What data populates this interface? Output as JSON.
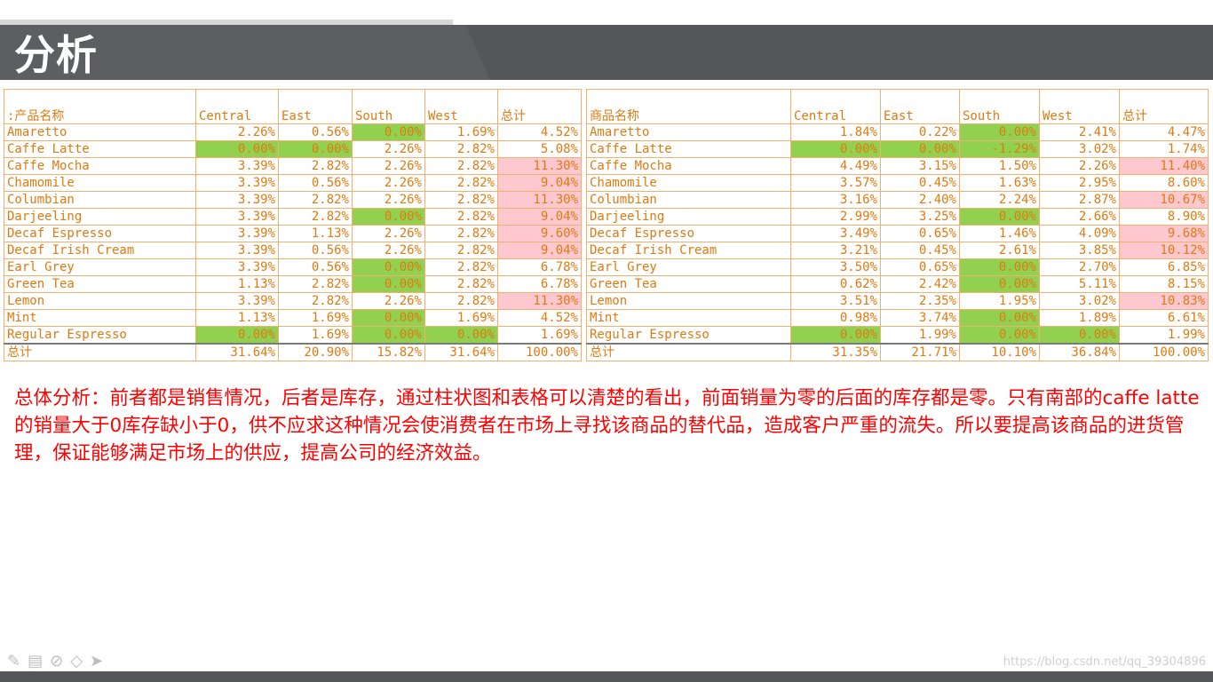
{
  "slide": {
    "title": "分析",
    "analysis_text": "总体分析：前者都是销售情况，后者是库存，通过柱状图和表格可以清楚的看出，前面销量为零的后面的库存都是零。只有南部的caffe latte的销量大于0库存缺小于0，供不应求这种情况会使消费者在市场上寻找该商品的替代品，造成客户严重的流失。所以要提高该商品的进货管理，保证能够满足市场上的供应，提高公司的经济效益。",
    "watermark": "https://blog.csdn.net/qq_39304896"
  },
  "icons": [
    "pen-icon",
    "slide-icon",
    "highlighter-icon",
    "eraser-icon",
    "pointer-icon"
  ],
  "colors": {
    "header_bg": "#545659",
    "text_orange": "#e07a10",
    "green_fill": "#92d050",
    "pink_fill": "#ffc7ce",
    "analysis_red": "#ff0000"
  },
  "tables": [
    {
      "corner": ":产品名称",
      "columns": [
        "Central",
        "East",
        "South",
        "West",
        "总计"
      ],
      "rows": [
        {
          "name": "Amaretto",
          "vals": [
            "2.26%",
            "0.56%",
            "0.00%",
            "1.69%",
            "4.52%"
          ],
          "fills": [
            "",
            "",
            "g",
            "",
            ""
          ]
        },
        {
          "name": "Caffe Latte",
          "vals": [
            "0.00%",
            "0.00%",
            "2.26%",
            "2.82%",
            "5.08%"
          ],
          "fills": [
            "g",
            "g",
            "",
            "",
            ""
          ]
        },
        {
          "name": "Caffe Mocha",
          "vals": [
            "3.39%",
            "2.82%",
            "2.26%",
            "2.82%",
            "11.30%"
          ],
          "fills": [
            "",
            "",
            "",
            "",
            "p"
          ]
        },
        {
          "name": "Chamomile",
          "vals": [
            "3.39%",
            "0.56%",
            "2.26%",
            "2.82%",
            "9.04%"
          ],
          "fills": [
            "",
            "",
            "",
            "",
            "p"
          ]
        },
        {
          "name": "Columbian",
          "vals": [
            "3.39%",
            "2.82%",
            "2.26%",
            "2.82%",
            "11.30%"
          ],
          "fills": [
            "",
            "",
            "",
            "",
            "p"
          ]
        },
        {
          "name": "Darjeeling",
          "vals": [
            "3.39%",
            "2.82%",
            "0.00%",
            "2.82%",
            "9.04%"
          ],
          "fills": [
            "",
            "",
            "g",
            "",
            "p"
          ]
        },
        {
          "name": "Decaf Espresso",
          "vals": [
            "3.39%",
            "1.13%",
            "2.26%",
            "2.82%",
            "9.60%"
          ],
          "fills": [
            "",
            "",
            "",
            "",
            "p"
          ]
        },
        {
          "name": "Decaf Irish Cream",
          "vals": [
            "3.39%",
            "0.56%",
            "2.26%",
            "2.82%",
            "9.04%"
          ],
          "fills": [
            "",
            "",
            "",
            "",
            "p"
          ]
        },
        {
          "name": "Earl Grey",
          "vals": [
            "3.39%",
            "0.56%",
            "0.00%",
            "2.82%",
            "6.78%"
          ],
          "fills": [
            "",
            "",
            "g",
            "",
            ""
          ]
        },
        {
          "name": "Green Tea",
          "vals": [
            "1.13%",
            "2.82%",
            "0.00%",
            "2.82%",
            "6.78%"
          ],
          "fills": [
            "",
            "",
            "g",
            "",
            ""
          ]
        },
        {
          "name": "Lemon",
          "vals": [
            "3.39%",
            "2.82%",
            "2.26%",
            "2.82%",
            "11.30%"
          ],
          "fills": [
            "",
            "",
            "",
            "",
            "p"
          ]
        },
        {
          "name": "Mint",
          "vals": [
            "1.13%",
            "1.69%",
            "0.00%",
            "1.69%",
            "4.52%"
          ],
          "fills": [
            "",
            "",
            "g",
            "",
            ""
          ]
        },
        {
          "name": "Regular Espresso",
          "vals": [
            "0.00%",
            "1.69%",
            "0.00%",
            "0.00%",
            "1.69%"
          ],
          "fills": [
            "g",
            "",
            "g",
            "g",
            ""
          ]
        }
      ],
      "total": {
        "name": "总计",
        "vals": [
          "31.64%",
          "20.90%",
          "15.82%",
          "31.64%",
          "100.00%"
        ]
      }
    },
    {
      "corner": "商品名称",
      "columns": [
        "Central",
        "East",
        "South",
        "West",
        "总计"
      ],
      "rows": [
        {
          "name": "Amaretto",
          "vals": [
            "1.84%",
            "0.22%",
            "0.00%",
            "2.41%",
            "4.47%"
          ],
          "fills": [
            "",
            "",
            "g",
            "",
            ""
          ]
        },
        {
          "name": "Caffe Latte",
          "vals": [
            "0.00%",
            "0.00%",
            "-1.29%",
            "3.02%",
            "1.74%"
          ],
          "fills": [
            "g",
            "g",
            "g",
            "",
            ""
          ]
        },
        {
          "name": "Caffe Mocha",
          "vals": [
            "4.49%",
            "3.15%",
            "1.50%",
            "2.26%",
            "11.40%"
          ],
          "fills": [
            "",
            "",
            "",
            "",
            "p"
          ]
        },
        {
          "name": "Chamomile",
          "vals": [
            "3.57%",
            "0.45%",
            "1.63%",
            "2.95%",
            "8.60%"
          ],
          "fills": [
            "",
            "",
            "",
            "",
            ""
          ]
        },
        {
          "name": "Columbian",
          "vals": [
            "3.16%",
            "2.40%",
            "2.24%",
            "2.87%",
            "10.67%"
          ],
          "fills": [
            "",
            "",
            "",
            "",
            "p"
          ]
        },
        {
          "name": "Darjeeling",
          "vals": [
            "2.99%",
            "3.25%",
            "0.00%",
            "2.66%",
            "8.90%"
          ],
          "fills": [
            "",
            "",
            "g",
            "",
            ""
          ]
        },
        {
          "name": "Decaf Espresso",
          "vals": [
            "3.49%",
            "0.65%",
            "1.46%",
            "4.09%",
            "9.68%"
          ],
          "fills": [
            "",
            "",
            "",
            "",
            "p"
          ]
        },
        {
          "name": "Decaf Irish Cream",
          "vals": [
            "3.21%",
            "0.45%",
            "2.61%",
            "3.85%",
            "10.12%"
          ],
          "fills": [
            "",
            "",
            "",
            "",
            "p"
          ]
        },
        {
          "name": "Earl Grey",
          "vals": [
            "3.50%",
            "0.65%",
            "0.00%",
            "2.70%",
            "6.85%"
          ],
          "fills": [
            "",
            "",
            "g",
            "",
            ""
          ]
        },
        {
          "name": "Green Tea",
          "vals": [
            "0.62%",
            "2.42%",
            "0.00%",
            "5.11%",
            "8.15%"
          ],
          "fills": [
            "",
            "",
            "g",
            "",
            ""
          ]
        },
        {
          "name": "Lemon",
          "vals": [
            "3.51%",
            "2.35%",
            "1.95%",
            "3.02%",
            "10.83%"
          ],
          "fills": [
            "",
            "",
            "",
            "",
            "p"
          ]
        },
        {
          "name": "Mint",
          "vals": [
            "0.98%",
            "3.74%",
            "0.00%",
            "1.89%",
            "6.61%"
          ],
          "fills": [
            "",
            "",
            "g",
            "",
            ""
          ]
        },
        {
          "name": "Regular Espresso",
          "vals": [
            "0.00%",
            "1.99%",
            "0.00%",
            "0.00%",
            "1.99%"
          ],
          "fills": [
            "g",
            "",
            "g",
            "g",
            ""
          ]
        }
      ],
      "total": {
        "name": "总计",
        "vals": [
          "31.35%",
          "21.71%",
          "10.10%",
          "36.84%",
          "100.00%"
        ]
      }
    }
  ]
}
